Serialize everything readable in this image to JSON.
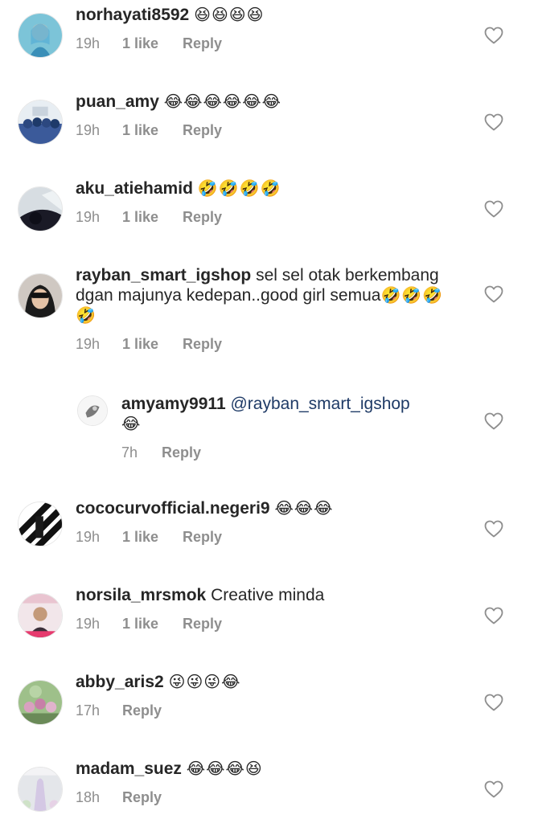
{
  "comments": [
    {
      "username": "norhayati8592",
      "text": "",
      "emoji": "😆😆😆😆",
      "time": "19h",
      "likes": "1 like",
      "reply": "Reply"
    },
    {
      "username": "puan_amy",
      "text": "",
      "emoji": "😂😂😂😂😂😂",
      "time": "19h",
      "likes": "1 like",
      "reply": "Reply"
    },
    {
      "username": "aku_atiehamid",
      "text": "",
      "emoji": "🤣🤣🤣🤣",
      "time": "19h",
      "likes": "1 like",
      "reply": "Reply"
    },
    {
      "username": "rayban_smart_igshop",
      "text": "sel sel otak berkembang dgan majunya kedepan..good girl semua",
      "emoji": "🤣🤣🤣🤣",
      "time": "19h",
      "likes": "1 like",
      "reply": "Reply"
    },
    {
      "username": "amyamy9911",
      "mention": "@rayban_smart_igshop",
      "emoji": "😂",
      "time": "7h",
      "reply": "Reply"
    },
    {
      "username": "cococurvofficial.negeri9",
      "text": "",
      "emoji": "😂😂😂",
      "time": "19h",
      "likes": "1 like",
      "reply": "Reply"
    },
    {
      "username": "norsila_mrsmok",
      "text": "Creative minda",
      "emoji": "",
      "time": "19h",
      "likes": "1 like",
      "reply": "Reply"
    },
    {
      "username": "abby_aris2",
      "text": "",
      "emoji": "😜😜😜😂",
      "time": "17h",
      "reply": "Reply"
    },
    {
      "username": "madam_suez",
      "text": "",
      "emoji": "😂😂😂😆",
      "time": "18h",
      "reply": "Reply"
    }
  ],
  "icons": {
    "like": "heart-outline-icon"
  },
  "colors": {
    "username": "#262626",
    "meta": "#8e8e8e",
    "mention": "#1e3a66",
    "heart": "#8e8e8e"
  }
}
